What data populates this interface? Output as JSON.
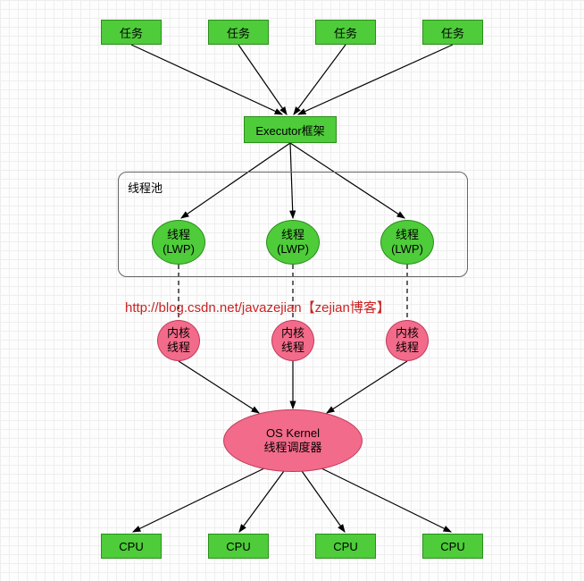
{
  "tasks": [
    "任务",
    "任务",
    "任务",
    "任务"
  ],
  "executor": {
    "label": "Executor框架"
  },
  "pool": {
    "label": "线程池",
    "threads": [
      "线程\n(LWP)",
      "线程\n(LWP)",
      "线程\n(LWP)"
    ]
  },
  "kernel_threads": [
    "内核\n线程",
    "内核\n线程",
    "内核\n线程"
  ],
  "os_kernel": {
    "line1": "OS Kernel",
    "line2": "线程调度器"
  },
  "cpus": [
    "CPU",
    "CPU",
    "CPU",
    "CPU"
  ],
  "watermark": {
    "url": "http://blog.csdn.net/javazejian",
    "tag": "【zejian博客】"
  }
}
